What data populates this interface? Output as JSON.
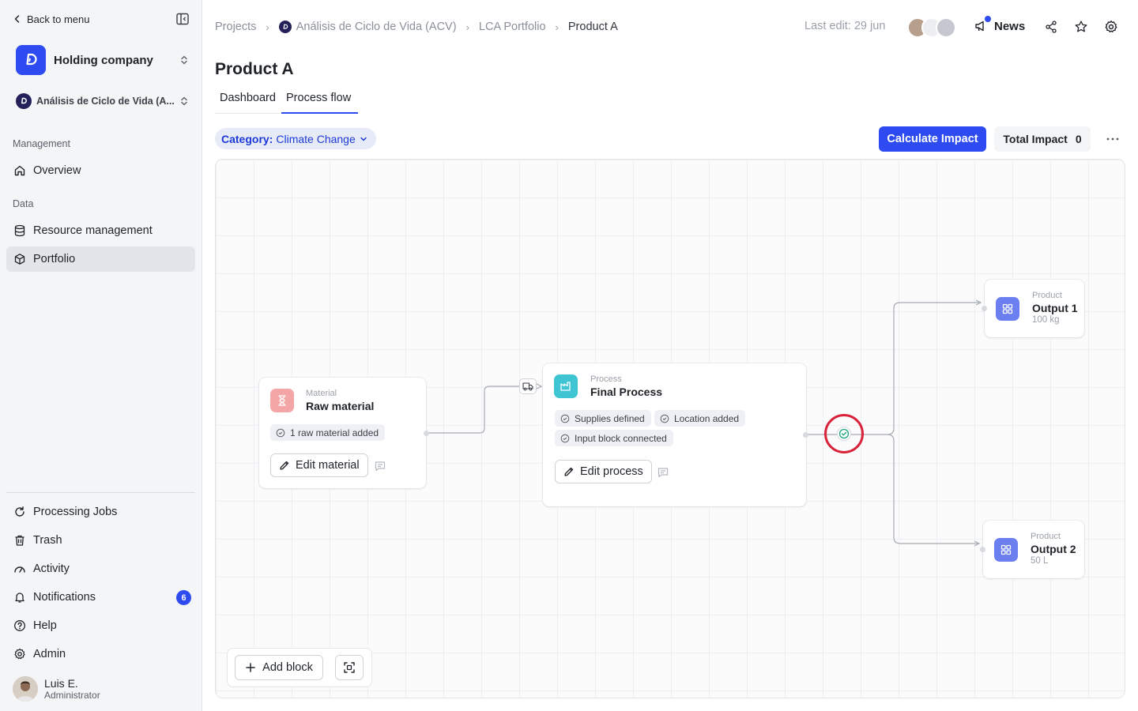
{
  "sidebar": {
    "back_label": "Back to menu",
    "org_name": "Holding company",
    "project_name": "Análisis de Ciclo de Vida (A...",
    "sections": {
      "management": "Management",
      "data": "Data"
    },
    "items": {
      "overview": "Overview",
      "resource_management": "Resource management",
      "portfolio": "Portfolio",
      "processing_jobs": "Processing Jobs",
      "trash": "Trash",
      "activity": "Activity",
      "notifications": "Notifications",
      "help": "Help",
      "admin": "Admin"
    },
    "notifications_count": "6",
    "user": {
      "name": "Luis E.",
      "role": "Administrator"
    }
  },
  "header": {
    "breadcrumbs": [
      "Projects",
      "Análisis de Ciclo de Vida (ACV)",
      "LCA Portfolio",
      "Product A"
    ],
    "last_edit": "Last edit: 29 jun",
    "news_label": "News"
  },
  "page": {
    "title": "Product A",
    "tabs": [
      "Dashboard",
      "Process flow"
    ],
    "category_key": "Category:",
    "category_value": "Climate Change",
    "calculate_label": "Calculate Impact",
    "total_label": "Total Impact",
    "total_value": "0"
  },
  "flow": {
    "material": {
      "type": "Material",
      "name": "Raw material",
      "chip": "1 raw material added",
      "edit_label": "Edit material"
    },
    "process": {
      "type": "Process",
      "name": "Final Process",
      "chips": [
        "Supplies defined",
        "Location added",
        "Input block connected"
      ],
      "edit_label": "Edit process"
    },
    "outputs": [
      {
        "type": "Product",
        "name": "Output 1",
        "qty": "100 kg"
      },
      {
        "type": "Product",
        "name": "Output 2",
        "qty": "50 L"
      }
    ],
    "toolbar": {
      "add_label": "Add block"
    }
  },
  "colors": {
    "accent": "#2d4bf0",
    "material_icon": "#f4a6a6",
    "process_icon": "#3fc4d3",
    "product_icon": "#6b7ff0",
    "highlight_ring": "#d9233a"
  }
}
